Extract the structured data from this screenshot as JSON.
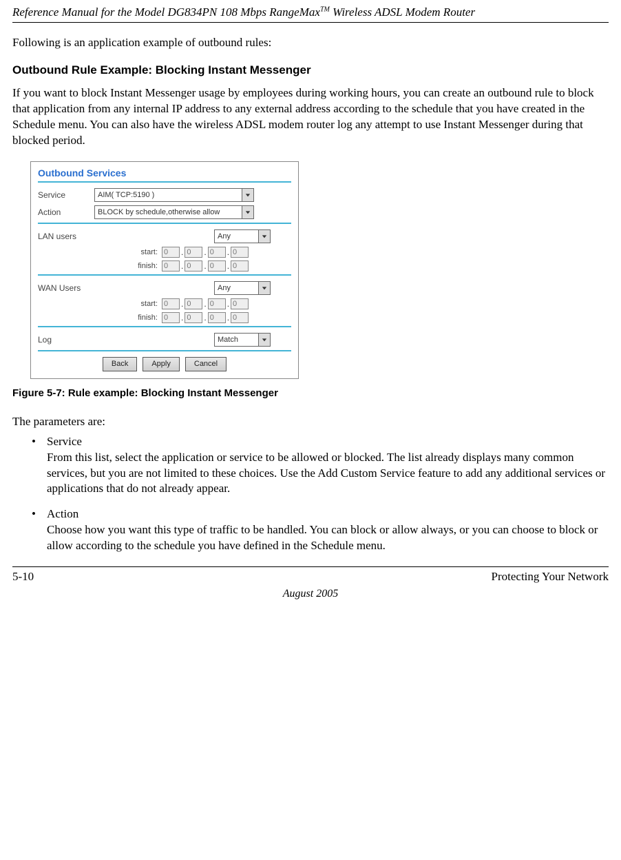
{
  "header": {
    "title_prefix": "Reference Manual for the Model DG834PN 108 Mbps RangeMax",
    "title_tm": "TM",
    "title_suffix": " Wireless ADSL Modem Router"
  },
  "intro_line": "Following is an application example of outbound rules:",
  "section_heading": "Outbound Rule Example: Blocking Instant Messenger",
  "example_paragraph": "If you want to block Instant Messenger usage by employees during working hours, you can create an outbound rule to block that application from any internal IP address to any external address according to the schedule that you have created in the Schedule menu. You can also have the wireless ADSL modem router log any attempt to use Instant Messenger during that blocked period.",
  "screenshot": {
    "panel_title": "Outbound Services",
    "labels": {
      "service": "Service",
      "action": "Action",
      "lan_users": "LAN users",
      "wan_users": "WAN Users",
      "start": "start:",
      "finish": "finish:",
      "log": "Log"
    },
    "values": {
      "service": "AIM( TCP:5190 )",
      "action": "BLOCK by schedule,otherwise allow",
      "lan_users_select": "Any",
      "wan_users_select": "Any",
      "log_select": "Match",
      "ip_octet": "0"
    },
    "buttons": {
      "back": "Back",
      "apply": "Apply",
      "cancel": "Cancel"
    }
  },
  "figure_caption": "Figure 5-7:  Rule example: Blocking Instant Messenger",
  "params_intro": "The parameters are:",
  "params": {
    "service": {
      "title": "Service",
      "body": "From this list, select the application or service to be allowed or blocked. The list already displays many common services, but you are not limited to these choices. Use the Add Custom Service feature to add any additional services or applications that do not already appear."
    },
    "action": {
      "title": "Action",
      "body": "Choose how you want this type of traffic to be handled. You can block or allow always, or you can choose to block or allow according to the schedule you have defined in the Schedule menu."
    }
  },
  "footer": {
    "page_num": "5-10",
    "section": "Protecting Your Network",
    "date": "August 2005"
  }
}
